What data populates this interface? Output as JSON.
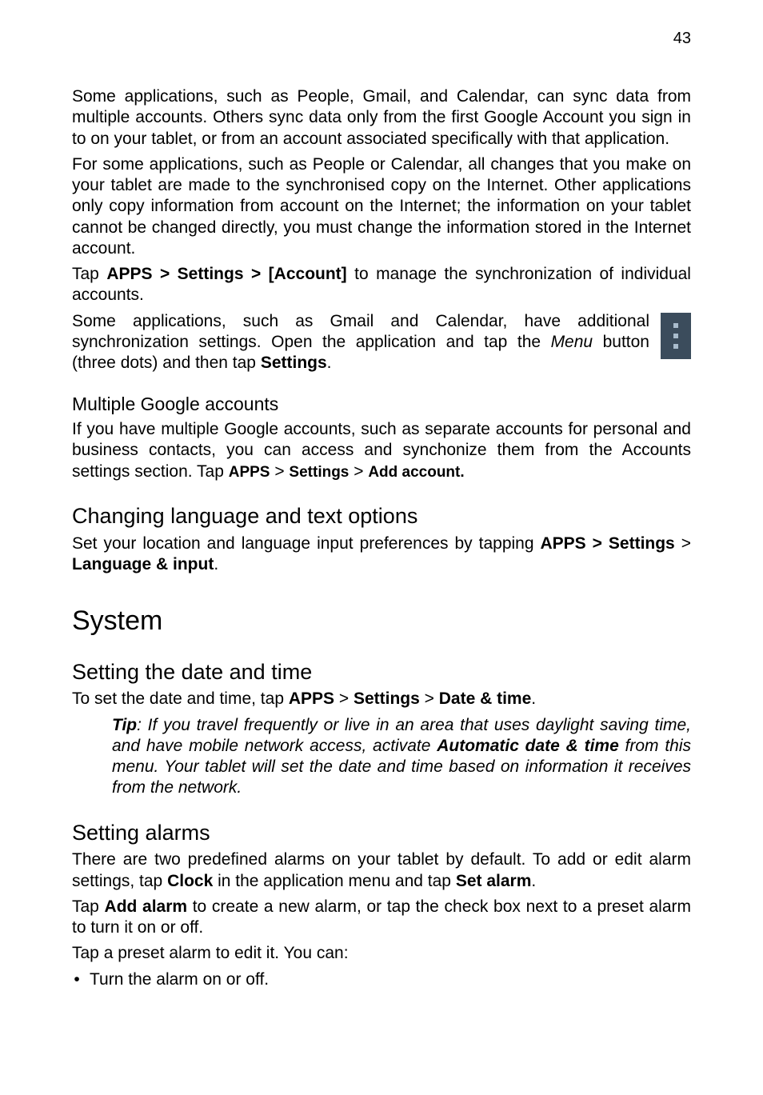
{
  "page_number": "43",
  "p1": "Some applications, such as People, Gmail, and Calendar, can sync data from multiple accounts. Others sync data only from the first Google Account you sign in to on your tablet, or from an account associated specifically with that application.",
  "p2": "For some applications, such as People or Calendar, all changes that you make on your tablet are made to the synchronised copy on the Internet. Other applications only copy information from account on the Internet; the information on your tablet cannot be changed directly, you must change the information stored in the Internet account.",
  "p3_prefix": "Tap ",
  "p3_bold": "APPS > Settings > [Account]",
  "p3_suffix": " to manage the synchronization of individual accounts.",
  "p4_a": "Some applications, such as Gmail and Calendar, have additional synchronization settings. Open the application and tap the ",
  "p4_menu": "Menu",
  "p4_b": " button (three dots) and then tap ",
  "p4_settings": "Settings",
  "p4_c": ".",
  "h_multi": "Multiple Google accounts",
  "p5_a": "If you have multiple Google accounts, such as separate accounts for personal and business contacts, you can access and synchonize them from the Accounts settings section. Tap ",
  "p5_apps": "APPS",
  "p5_gt1": " > ",
  "p5_settings": "Settings",
  "p5_gt2": " > ",
  "p5_add": "Add account.",
  "h_lang": "Changing language and text options",
  "p6_a": "Set your location and language input preferences by tapping ",
  "p6_bold": "APPS > Settings",
  "p6_b": " > ",
  "p6_lang": "Language & input",
  "p6_c": ".",
  "h_system": "System",
  "h_date": "Setting the date and time",
  "p7_a": "To set the date and time, tap ",
  "p7_apps": "APPS",
  "p7_gt1": " > ",
  "p7_settings": "Settings",
  "p7_gt2": " > ",
  "p7_dt": "Date & time",
  "p7_c": ".",
  "tip_label": "Tip",
  "tip_a": ": If you travel frequently or live in an area that uses daylight saving time, and have mobile network access, activate ",
  "tip_bold": "Automatic date & time",
  "tip_b": " from this menu. Your tablet will set the date and time based on information it receives from the network.",
  "h_alarms": "Setting alarms",
  "p8_a": "There are two predefined alarms on your tablet by default. To add or edit alarm settings, tap ",
  "p8_clock": "Clock",
  "p8_b": " in the application menu and tap ",
  "p8_set": "Set alarm",
  "p8_c": ".",
  "p9_a": "Tap ",
  "p9_add": "Add alarm",
  "p9_b": " to create a new alarm, or tap the check box next to a preset alarm to turn it on or off.",
  "p10": "Tap a preset alarm to edit it. You can:",
  "bullet1": "Turn the alarm on or off."
}
